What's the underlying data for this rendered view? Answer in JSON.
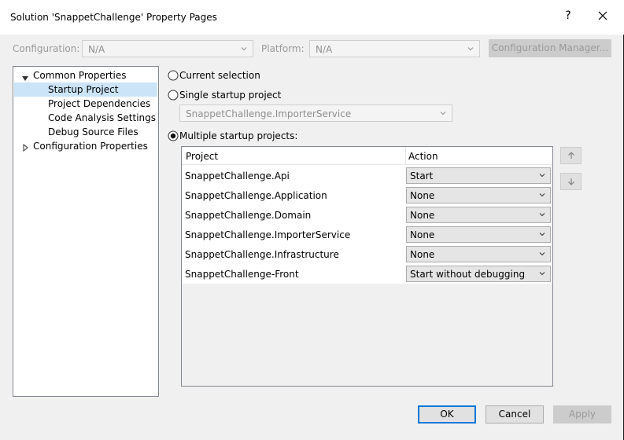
{
  "window": {
    "title": "Solution 'SnappetChallenge' Property Pages",
    "help_glyph": "?",
    "close_icon": "close-icon"
  },
  "config_bar": {
    "configuration_label": "Configuration:",
    "configuration_value": "N/A",
    "platform_label": "Platform:",
    "platform_value": "N/A",
    "manager_button": "Configuration Manager..."
  },
  "tree": {
    "items": [
      {
        "label": "Common Properties",
        "expanded": true
      },
      {
        "label": "Startup Project",
        "selected": true
      },
      {
        "label": "Project Dependencies"
      },
      {
        "label": "Code Analysis Settings"
      },
      {
        "label": "Debug Source Files"
      },
      {
        "label": "Configuration Properties",
        "expanded": false
      }
    ]
  },
  "startup": {
    "current_selection": "Current selection",
    "single_startup": "Single startup project",
    "single_value": "SnappetChallenge.ImporterService",
    "multiple_startup": "Multiple startup projects:",
    "selected_option": "multiple"
  },
  "grid": {
    "headers": {
      "project": "Project",
      "action": "Action"
    },
    "rows": [
      {
        "project": "SnappetChallenge.Api",
        "action": "Start"
      },
      {
        "project": "SnappetChallenge.Application",
        "action": "None"
      },
      {
        "project": "SnappetChallenge.Domain",
        "action": "None"
      },
      {
        "project": "SnappetChallenge.ImporterService",
        "action": "None"
      },
      {
        "project": "SnappetChallenge.Infrastructure",
        "action": "None"
      },
      {
        "project": "SnappetChallenge-Front",
        "action": "Start without debugging"
      }
    ]
  },
  "move_buttons": {
    "up_icon": "arrow-up-icon",
    "down_icon": "arrow-down-icon"
  },
  "footer": {
    "ok": "OK",
    "cancel": "Cancel",
    "apply": "Apply"
  },
  "colors": {
    "selection": "#cce4f7",
    "accent": "#0078d7",
    "dialog_bg": "#f0f0f0"
  }
}
